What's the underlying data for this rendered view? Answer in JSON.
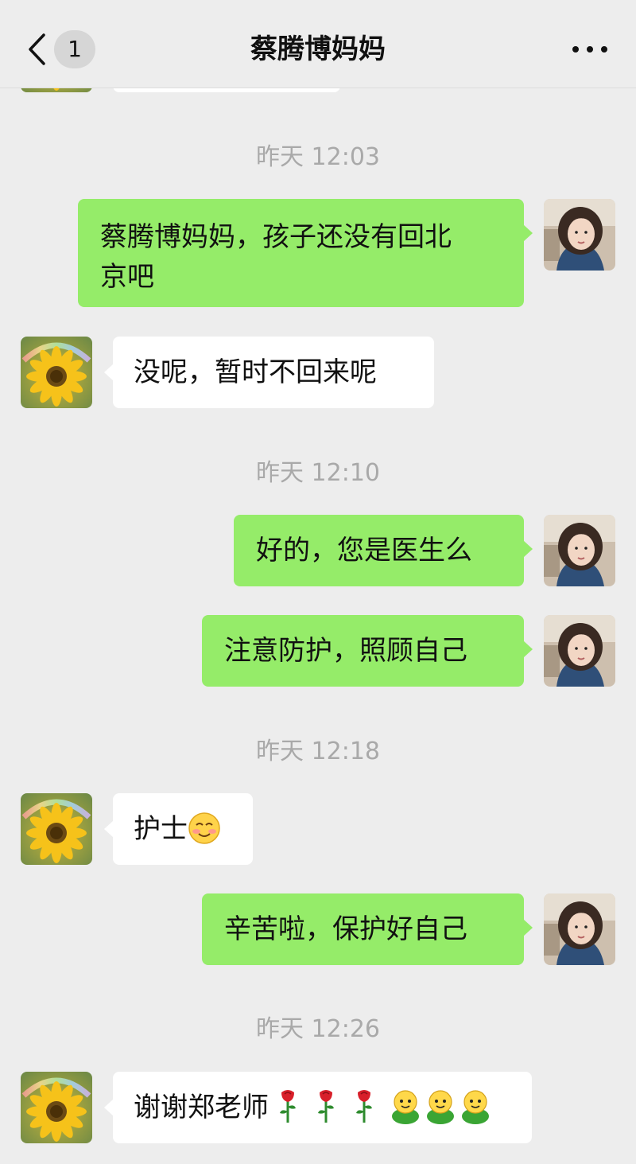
{
  "header": {
    "back_label": "返回",
    "unread_count": "1",
    "title": "蔡腾博妈妈",
    "more_icon": "more-dots-icon"
  },
  "colors": {
    "background": "#ededed",
    "sent_bubble": "#95ec69",
    "received_bubble": "#ffffff",
    "timestamp": "#a9a9a9"
  },
  "messages": [
    {
      "type": "timestamp",
      "text": "昨天 12:03"
    },
    {
      "type": "sent",
      "text_line1": "蔡腾博妈妈，孩子还没有回北",
      "text_line2": "京吧"
    },
    {
      "type": "received",
      "text": "没呢，暂时不回来呢"
    },
    {
      "type": "timestamp",
      "text": "昨天 12:10"
    },
    {
      "type": "sent",
      "text": "好的，您是医生么"
    },
    {
      "type": "sent",
      "text": "注意防护，照顾自己"
    },
    {
      "type": "timestamp",
      "text": "昨天 12:18"
    },
    {
      "type": "received",
      "text": "护士",
      "emoji": "blush-smile-emoji"
    },
    {
      "type": "sent",
      "text": "辛苦啦，保护好自己"
    },
    {
      "type": "timestamp",
      "text": "昨天 12:26"
    },
    {
      "type": "received",
      "text": "谢谢郑老师",
      "emoji": [
        "rose-emoji",
        "rose-emoji",
        "rose-emoji",
        "green-bean-emoji",
        "green-bean-emoji",
        "green-bean-emoji"
      ]
    }
  ]
}
